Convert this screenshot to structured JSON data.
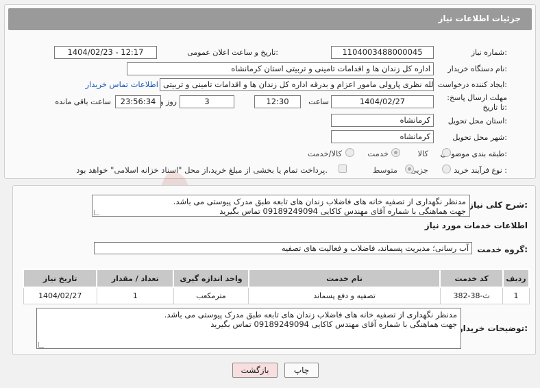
{
  "header": {
    "title": "جزئیات اطلاعات نیاز"
  },
  "labels": {
    "need_number": "شماره نیاز:",
    "announce_datetime": "تاریخ و ساعت اعلان عمومی:",
    "buyer_org": "نام دستگاه خریدار:",
    "requester": "ایجاد کننده درخواست:",
    "deadline": "مهلت ارسال پاسخ: تا تاریخ:",
    "time": "ساعت",
    "day_and": "روز و",
    "remaining": "ساعت باقی مانده",
    "delivery_province": "استان محل تحویل:",
    "delivery_city": "شهر محل تحویل:",
    "category": "طبقه بندی موضوعی:",
    "process_type": "نوع فرآیند خرید :",
    "general_desc": "شرح کلی نیاز:",
    "services_info": "اطلاعات خدمات مورد نیاز",
    "service_group": "گروه خدمت:",
    "buyer_notes": "توضیحات خریدار:"
  },
  "values": {
    "need_number": "1104003488000045",
    "announce_datetime": "1404/02/23 - 12:17",
    "buyer_org": "اداره کل زندان ها و اقدامات تامینی و تربیتی استان کرمانشاه",
    "requester": "عزیزالله نظری پارولی مامور اعزام و بدرقه اداره کل زندان ها و اقدامات تامینی و تربیتی",
    "buyer_contact_link": "اطلاعات تماس خریدار",
    "deadline_date": "1404/02/27",
    "deadline_time": "12:30",
    "remaining_days": "3",
    "remaining_time": "23:56:34",
    "delivery_province": "کرمانشاه",
    "delivery_city": "کرمانشاه",
    "service_group": "آب رسانی؛ مدیریت پسماند، فاضلاب و فعالیت های تصفیه"
  },
  "category_options": [
    "کالا",
    "خدمت",
    "کالا/خدمت"
  ],
  "category_selected": "خدمت",
  "process_options": [
    "جزیی",
    "متوسط"
  ],
  "process_selected": "متوسط",
  "payment_note": "پرداخت تمام یا بخشی از مبلغ خرید،از محل \"اسناد خزانه اسلامی\" خواهد بود.",
  "general_desc_lines": [
    "مدنظر نگهداری از تصفیه خانه های فاضلاب زندان های تابعه طبق مدرک پیوستی می باشد.",
    "جهت هماهنگی با شماره آقای مهندس کاکایی 09189249094 تماس بگیرید"
  ],
  "table": {
    "headers": [
      "ردیف",
      "کد خدمت",
      "نام خدمت",
      "واحد اندازه گیری",
      "تعداد / مقدار",
      "تاریخ نیاز"
    ],
    "rows": [
      [
        "1",
        "ث-38-382",
        "تصفیه و دفع پسماند",
        "مترمکعب",
        "1",
        "1404/02/27"
      ]
    ]
  },
  "buyer_notes_lines": [
    "مدنظر نگهداری از تصفیه خانه های فاضلاب زندان های تابعه طبق مدرک پیوستی می باشد.",
    "جهت هماهنگی با شماره آقای مهندس کاکایی 09189249094 تماس بگیرید"
  ],
  "buttons": {
    "print": "چاپ",
    "back": "بازگشت"
  },
  "colors": {
    "header_bg": "#9a9a9a",
    "link": "#1a56b8",
    "back_btn_bg": "#f8dede",
    "table_header": "#c8c8c8"
  }
}
